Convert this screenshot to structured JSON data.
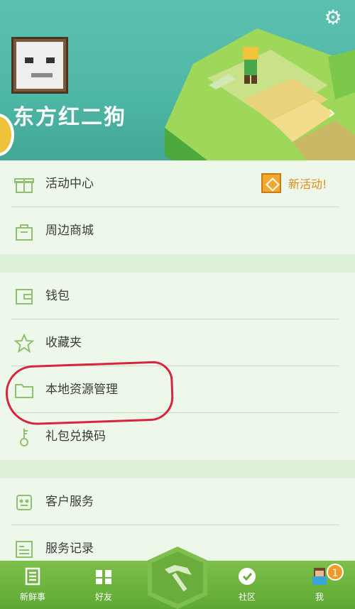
{
  "header": {
    "username": "东方红二狗"
  },
  "menu": {
    "group1": [
      {
        "label": "活动中心",
        "icon": "gift-icon"
      },
      {
        "label": "周边商城",
        "icon": "shopping-bag-icon"
      }
    ],
    "activity_badge": "新活动!",
    "group2": [
      {
        "label": "钱包",
        "icon": "wallet-icon"
      },
      {
        "label": "收藏夹",
        "icon": "star-icon"
      },
      {
        "label": "本地资源管理",
        "icon": "folder-icon"
      },
      {
        "label": "礼包兑换码",
        "icon": "key-icon"
      }
    ],
    "group3": [
      {
        "label": "客户服务",
        "icon": "customer-service-icon"
      },
      {
        "label": "服务记录",
        "icon": "records-icon"
      }
    ]
  },
  "tabbar": {
    "tabs": [
      {
        "label": "新鲜事",
        "icon": "news-icon"
      },
      {
        "label": "好友",
        "icon": "friends-icon"
      },
      {
        "label": "社区",
        "icon": "community-icon"
      },
      {
        "label": "我",
        "icon": "me-avatar-icon"
      }
    ],
    "center_icon": "pickaxe-icon",
    "notification_count": "1"
  },
  "colors": {
    "header_teal": "#4fb7a6",
    "accent_green": "#6aad3c",
    "icon_green": "#8fc070",
    "badge_orange": "#e08c1a",
    "annotation_red": "#d8243c"
  }
}
